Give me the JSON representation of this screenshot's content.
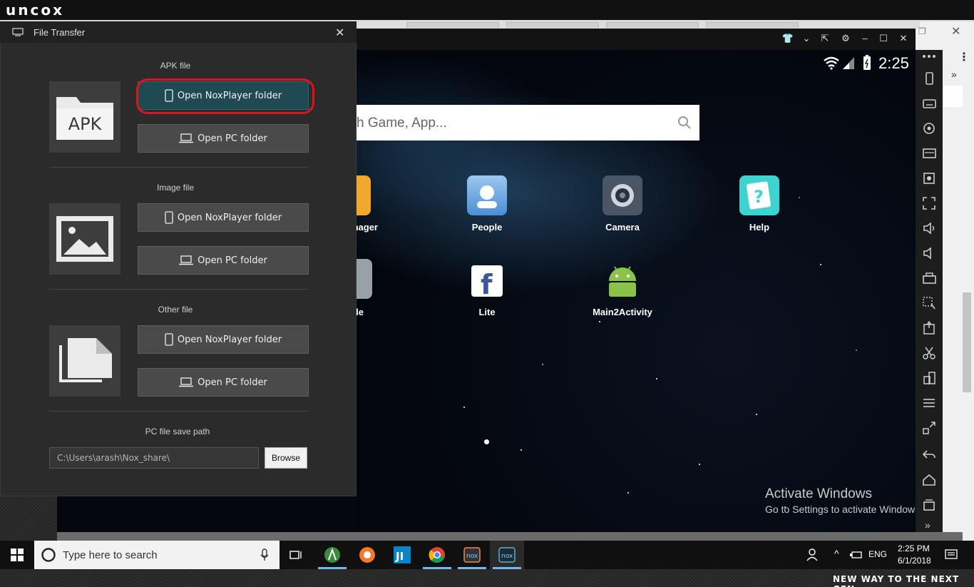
{
  "brand": {
    "logo_text": "uncox",
    "tagline": "NEW WAY TO THE NEXT GEN ›"
  },
  "file_transfer": {
    "title": "File Transfer",
    "sections": [
      {
        "label": "APK file",
        "thumb_text": "APK",
        "nox_button": "Open NoxPlayer folder",
        "pc_button": "Open PC folder"
      },
      {
        "label": "Image file",
        "nox_button": "Open NoxPlayer folder",
        "pc_button": "Open PC folder"
      },
      {
        "label": "Other file",
        "nox_button": "Open NoxPlayer folder",
        "pc_button": "Open PC folder"
      }
    ],
    "save_path_label": "PC file save path",
    "save_path_value": "C:\\Users\\arash\\Nox_share\\",
    "browse_label": "Browse"
  },
  "emulator": {
    "clock": "2:25",
    "search_placeholder": "h Game, App...",
    "apps": [
      {
        "label": "nager"
      },
      {
        "label": "People"
      },
      {
        "label": "Camera"
      },
      {
        "label": "Help"
      },
      {
        "label": "le"
      },
      {
        "label": "Lite"
      },
      {
        "label": "Main2Activity"
      }
    ],
    "watermark_title": "Activate Windows",
    "watermark_sub": "Go to Settings to activate Windows."
  },
  "taskbar": {
    "search_placeholder": "Type here to search",
    "language": "ENG",
    "time": "2:25 PM",
    "date": "6/1/2018"
  },
  "colors": {
    "accent_red": "#e0121b",
    "primary_button": "#1f4a54",
    "dialog_bg": "#2b2b2b"
  }
}
